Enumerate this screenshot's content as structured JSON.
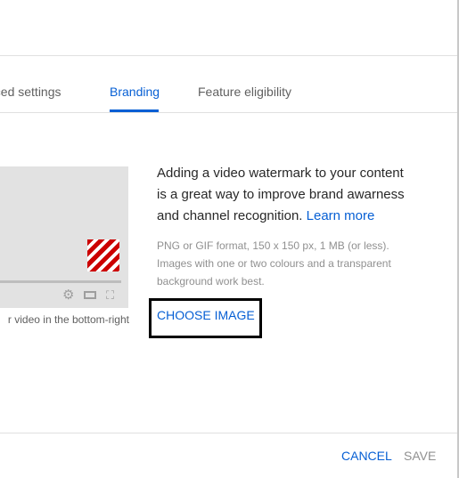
{
  "tabs": [
    {
      "label": "nced settings",
      "active": false
    },
    {
      "label": "Branding",
      "active": true
    },
    {
      "label": "Feature eligibility",
      "active": false
    }
  ],
  "watermark": {
    "description_text": "Adding a video watermark to your content is a great way to improve brand awarness and channel recognition.",
    "learn_more_label": "Learn more",
    "format_note": "PNG or GIF format, 150 x 150 px, 1 MB (or less). Images with one or two colours and a transparent background work best.",
    "choose_image_label": "CHOOSE IMAGE",
    "preview_caption": "r video in the bottom-right"
  },
  "footer": {
    "cancel_label": "CANCEL",
    "save_label": "SAVE"
  },
  "colors": {
    "accent": "#065fd4",
    "watermark_stripe": "#cc0000",
    "disabled": "#909090"
  },
  "icons": {
    "settings": "gear-icon",
    "theater": "theater-mode-icon",
    "fullscreen": "fullscreen-icon"
  }
}
